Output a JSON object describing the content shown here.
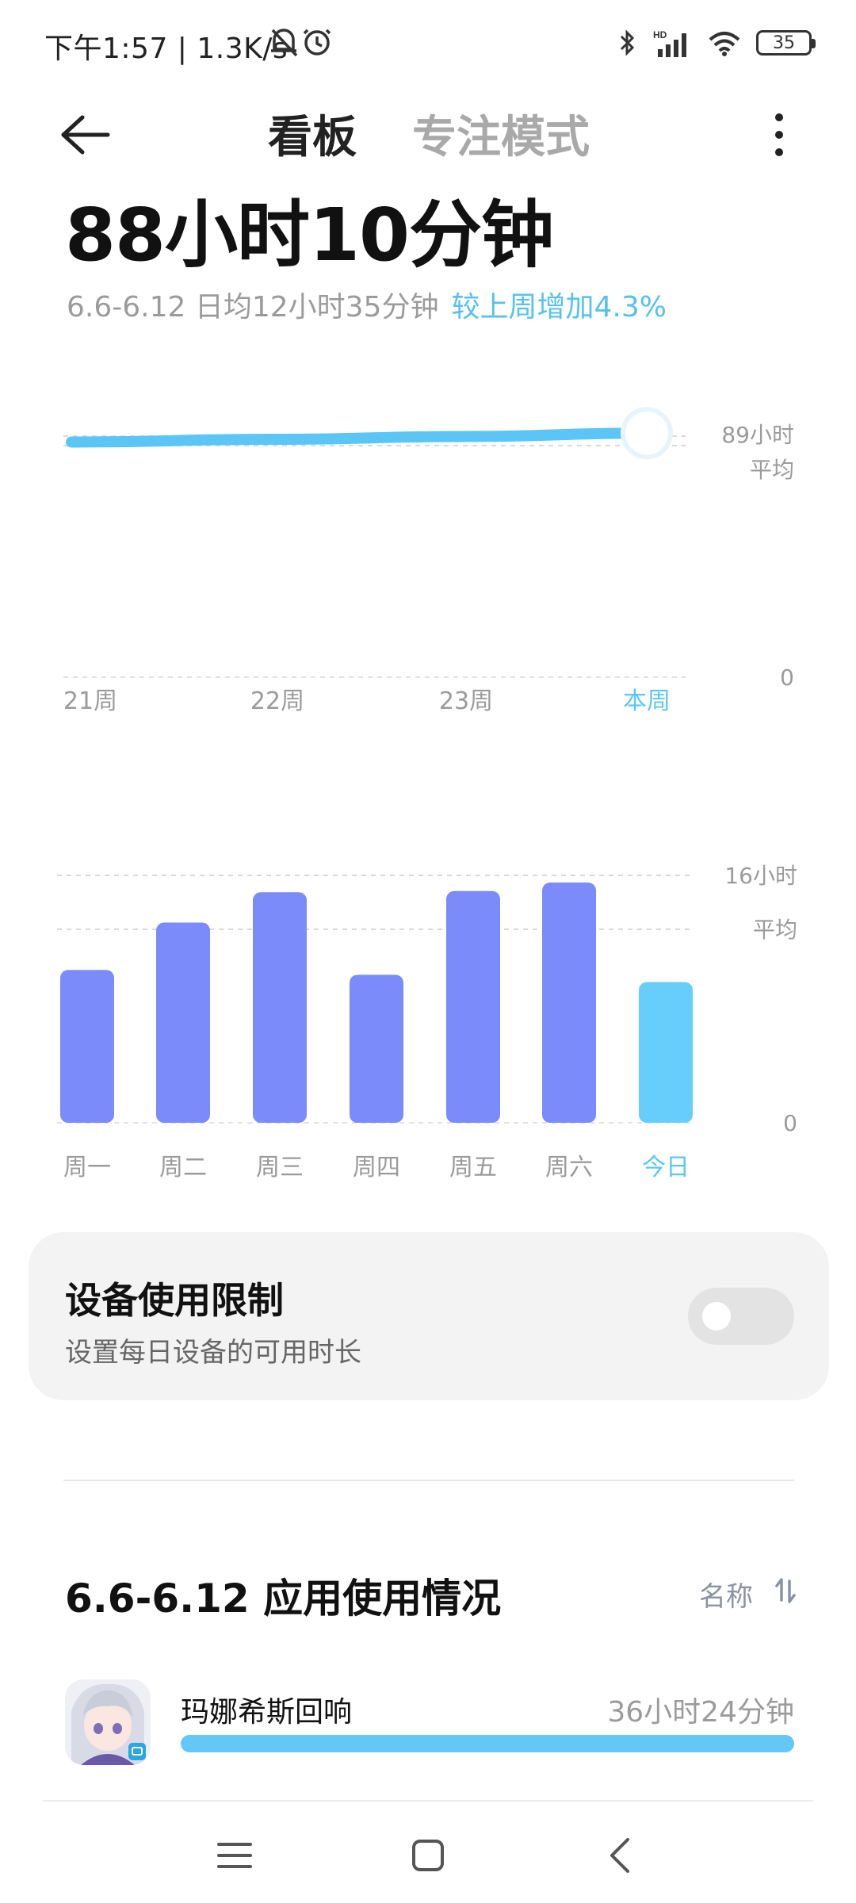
{
  "status_bar": {
    "text": "下午1:57 | 1.3K/s",
    "battery": "35"
  },
  "header": {
    "tab_active": "看板",
    "tab_inactive": "专注模式"
  },
  "summary": {
    "total": "88小时10分钟",
    "detail": "6.6-6.12 日均12小时35分钟",
    "change": "较上周增加4.3%"
  },
  "colors": {
    "accent": "#5BC6F5",
    "bar": "#7B8BFA",
    "today_bar": "#67CEFB",
    "text_muted": "#9B9B9B"
  },
  "weekly_chart": {
    "avg_label_value": "89小时",
    "avg_label_text": "平均",
    "zero": "0",
    "x_labels": [
      "21周",
      "22周",
      "23周",
      "本周"
    ]
  },
  "daily_chart": {
    "top_label": "16小时",
    "avg_label": "平均",
    "zero": "0",
    "x_labels": [
      "周一",
      "周二",
      "周三",
      "周四",
      "周五",
      "周六",
      "今日"
    ]
  },
  "chart_data": [
    {
      "type": "line",
      "x": [
        "21周",
        "22周",
        "23周",
        "本周"
      ],
      "series": [
        {
          "values": [
            85,
            86,
            87,
            88.2
          ]
        }
      ],
      "ylim": [
        0,
        90
      ],
      "reference_lines": [
        {
          "label": "平均",
          "value": 87.5
        }
      ],
      "y_tick_labels": [
        "89小时",
        "0"
      ],
      "highlighted": "本周"
    },
    {
      "type": "bar",
      "categories": [
        "周一",
        "周二",
        "周三",
        "周四",
        "周五",
        "周六",
        "今日"
      ],
      "values": [
        12.6,
        16.5,
        19.0,
        12.2,
        19.1,
        19.8,
        11.6
      ],
      "ylim": [
        0,
        20
      ],
      "y_tick_labels": [
        "16小时",
        "平均",
        "0"
      ],
      "reference_lines": [
        {
          "label": "平均",
          "value": 16
        }
      ],
      "highlighted": "今日"
    }
  ],
  "device_limit": {
    "title": "设备使用限制",
    "subtitle": "设置每日设备的可用时长",
    "enabled": false
  },
  "app_usage": {
    "title": "6.6-6.12 应用使用情况",
    "sort_label": "名称",
    "items": [
      {
        "name": "玛娜希斯回响",
        "time": "36小时24分钟",
        "progress": 1.0
      }
    ]
  }
}
